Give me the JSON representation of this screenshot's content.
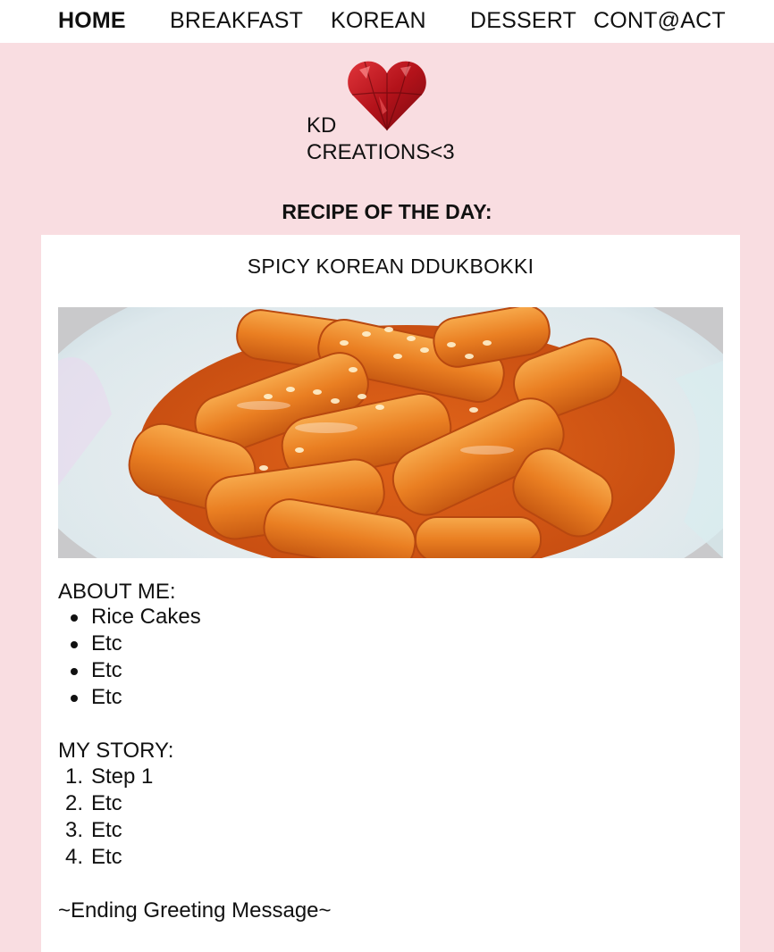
{
  "nav": {
    "items": [
      {
        "label": "HOME",
        "active": true
      },
      {
        "label": "BREAKFAST",
        "active": false
      },
      {
        "label": "KOREAN",
        "active": false
      },
      {
        "label": "DESSERT",
        "active": false
      },
      {
        "label": "CONT@ACT",
        "active": false
      }
    ]
  },
  "logo": {
    "line1": "KD",
    "line2": "CREATIONS<3",
    "icon": "red-crystal-heart-icon"
  },
  "recipe_of_day_label": "RECIPE OF THE DAY:",
  "recipe": {
    "title": "SPICY KOREAN DDUKBOKKI",
    "image_alt": "spicy korean ddukbokki",
    "about_label": "ABOUT ME:",
    "about_items": [
      "Rice Cakes",
      "Etc",
      "Etc",
      "Etc"
    ],
    "story_label": "MY STORY:",
    "story_items": [
      {
        "num": "1.",
        "text": "Step 1"
      },
      {
        "num": "2.",
        "text": "Etc"
      },
      {
        "num": "3.",
        "text": "Etc"
      },
      {
        "num": "4.",
        "text": "Etc"
      }
    ],
    "ending": "~Ending Greeting Message~"
  },
  "colors": {
    "page_bg": "#f9dde1",
    "nav_bg": "#ffffff",
    "card_bg": "#ffffff",
    "heart": "#c4161c"
  }
}
